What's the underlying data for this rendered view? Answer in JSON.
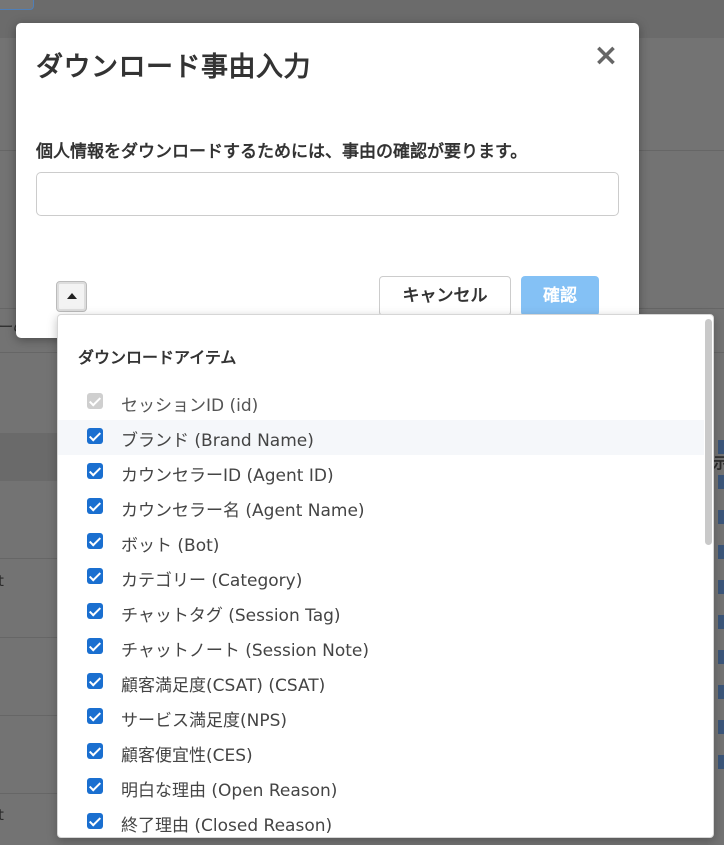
{
  "modal": {
    "title": "ダウンロード事由入力",
    "close_icon": "close-icon",
    "label": "個人情報をダウンロードするためには、事由の確認が要ります。",
    "reason_input": {
      "value": "",
      "placeholder": ""
    },
    "cancel_label": "キャンセル",
    "confirm_label": "確認",
    "confirm_color": "#84c1f5"
  },
  "background": {
    "fragment_1": "ーの",
    "fragment_2": "t",
    "fragment_3": "t",
    "fragment_4": "示"
  },
  "dropdown": {
    "title": "ダウンロードアイテム",
    "items": [
      {
        "label": "セッションID (id)",
        "checked": true,
        "disabled": true
      },
      {
        "label": "ブランド (Brand Name)",
        "checked": true,
        "disabled": false
      },
      {
        "label": "カウンセラーID (Agent ID)",
        "checked": true,
        "disabled": false
      },
      {
        "label": "カウンセラー名 (Agent Name)",
        "checked": true,
        "disabled": false
      },
      {
        "label": "ボット (Bot)",
        "checked": true,
        "disabled": false
      },
      {
        "label": "カテゴリー (Category)",
        "checked": true,
        "disabled": false
      },
      {
        "label": "チャットタグ (Session Tag)",
        "checked": true,
        "disabled": false
      },
      {
        "label": "チャットノート (Session Note)",
        "checked": true,
        "disabled": false
      },
      {
        "label": "顧客満足度(CSAT) (CSAT)",
        "checked": true,
        "disabled": false
      },
      {
        "label": "サービス満足度(NPS)",
        "checked": true,
        "disabled": false
      },
      {
        "label": "顧客便宜性(CES)",
        "checked": true,
        "disabled": false
      },
      {
        "label": "明白な理由 (Open Reason)",
        "checked": true,
        "disabled": false
      },
      {
        "label": "終了理由 (Closed Reason)",
        "checked": true,
        "disabled": false
      }
    ],
    "checkbox_color": "#1a6fd0"
  }
}
